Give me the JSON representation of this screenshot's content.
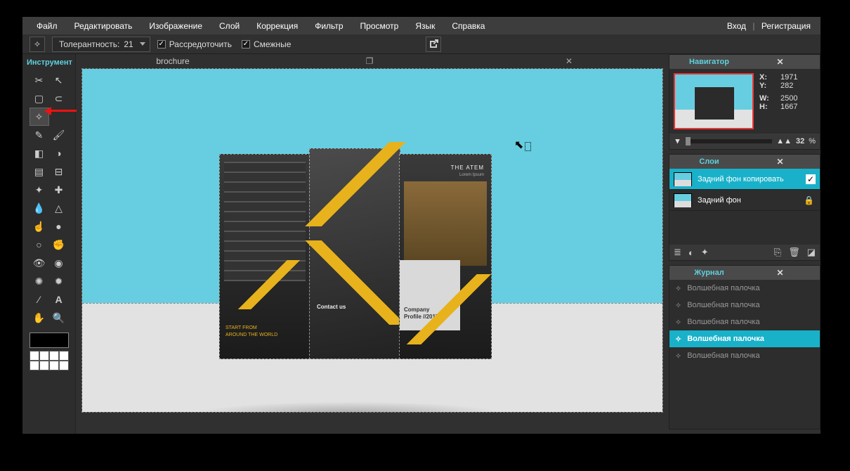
{
  "menu": {
    "items": [
      "Файл",
      "Редактировать",
      "Изображение",
      "Слой",
      "Коррекция",
      "Фильтр",
      "Просмотр",
      "Язык",
      "Справка"
    ],
    "login": "Вход",
    "sep": "|",
    "register": "Регистрация"
  },
  "options": {
    "tolerance_label": "Толерантность:",
    "tolerance_value": "21",
    "cb1": "Рассредоточить",
    "cb2": "Смежные"
  },
  "tool_panel_title": "Инструмент",
  "document": {
    "title": "brochure"
  },
  "cursor_glyph": "⬉",
  "navigator": {
    "title": "Навигатор",
    "coords": {
      "x_label": "X:",
      "x": "1971",
      "y_label": "Y:",
      "y": "282",
      "w_label": "W:",
      "w": "2500",
      "h_label": "H:",
      "h": "1667"
    },
    "zoom": "32",
    "pct": "%"
  },
  "layers": {
    "title": "Слои",
    "items": [
      {
        "name": "Задний фон копировать",
        "active": true,
        "locked": false,
        "checked": true
      },
      {
        "name": "Задний фон",
        "active": false,
        "locked": true,
        "checked": false
      }
    ]
  },
  "history": {
    "title": "Журнал",
    "items": [
      {
        "label": "Волшебная палочка",
        "current": false
      },
      {
        "label": "Волшебная палочка",
        "current": false
      },
      {
        "label": "Волшебная палочка",
        "current": false
      },
      {
        "label": "Волшебная палочка",
        "current": true
      },
      {
        "label": "Волшебная палочка",
        "current": false
      }
    ]
  },
  "brochure_text": {
    "theatem": "THE ATEM",
    "sub": "Lorem Ipsum",
    "contact": "Contact us",
    "company1": "Company",
    "company2": "Profile //2017",
    "tag1": "START FROM",
    "tag2": "AROUND THE WORLD"
  },
  "icons": {
    "wand": "✧",
    "zoom_out": "▲",
    "zoom_in": "▲",
    "lock": "🔒",
    "check": "✓",
    "trash": "🗑",
    "copy": "⎘",
    "share": "↗"
  }
}
